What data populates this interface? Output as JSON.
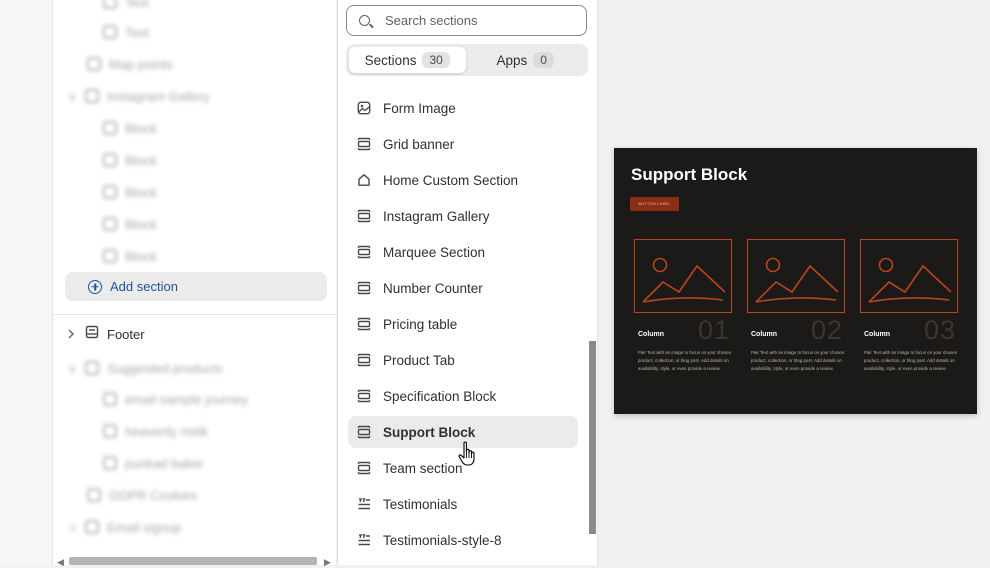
{
  "tree": {
    "blurred_items": [
      "Text",
      "Text",
      "Map points",
      "Instagram Gallery",
      "Block",
      "Block",
      "Block",
      "Block",
      "Block",
      "Suggested products",
      "email sample journey",
      "heavenly melk",
      "punkad baker",
      "GDPR Cookies",
      "Email signup"
    ],
    "add_section_label": "Add section",
    "footer_label": "Footer"
  },
  "picker": {
    "search_placeholder": "Search sections",
    "tabs": [
      {
        "label": "Sections",
        "count": "30"
      },
      {
        "label": "Apps",
        "count": "0"
      }
    ],
    "items": [
      {
        "label": "Form Image",
        "icon": "image-icon"
      },
      {
        "label": "Grid banner",
        "icon": "layout-section-icon"
      },
      {
        "label": "Home Custom Section",
        "icon": "home-icon"
      },
      {
        "label": "Instagram Gallery",
        "icon": "layout-section-icon"
      },
      {
        "label": "Marquee Section",
        "icon": "layout-section-icon"
      },
      {
        "label": "Number Counter",
        "icon": "layout-section-icon"
      },
      {
        "label": "Pricing table",
        "icon": "layout-section-icon"
      },
      {
        "label": "Product Tab",
        "icon": "layout-section-icon"
      },
      {
        "label": "Specification Block",
        "icon": "layout-section-icon"
      },
      {
        "label": "Support Block",
        "icon": "layout-section-icon"
      },
      {
        "label": "Team section",
        "icon": "layout-section-icon"
      },
      {
        "label": "Testimonials",
        "icon": "text-list-icon"
      },
      {
        "label": "Testimonials-style-8",
        "icon": "text-list-icon"
      }
    ],
    "hovered_item": "Support Block"
  },
  "preview": {
    "title": "Support Block",
    "button_label": "BUTTON LABEL",
    "columns": [
      {
        "number": "01",
        "heading": "Column",
        "text": "Pair Text with an image to focus on your chosen product, collection, or blog post. Add details on availability, style, or even provide a review."
      },
      {
        "number": "02",
        "heading": "Column",
        "text": "Pair Text with an image to focus on your chosen product, collection, or blog post. Add details on availability, style, or even provide a review."
      },
      {
        "number": "03",
        "heading": "Column",
        "text": "Pair Text with an image to focus on your chosen product, collection, or blog post. Add details on availability, style, or even provide a review."
      }
    ],
    "colors": {
      "background": "#1c1a18",
      "accent": "#b8451b",
      "button": "#8a2e17"
    }
  }
}
